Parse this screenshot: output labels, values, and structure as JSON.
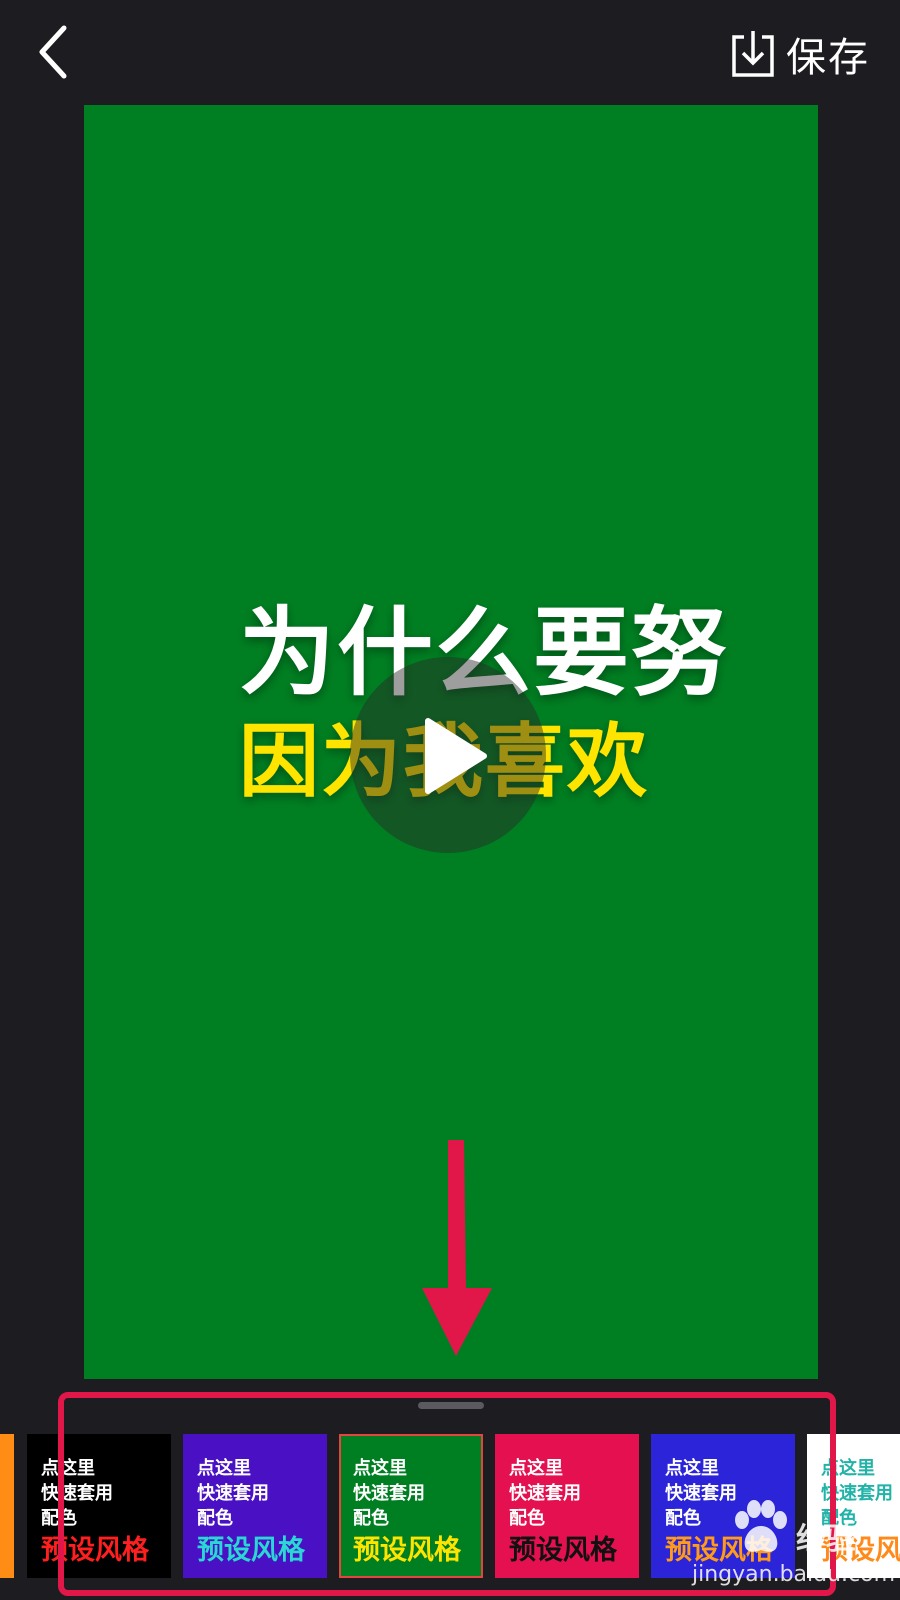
{
  "header": {
    "save_label": "保存"
  },
  "video": {
    "line1": "为什么要努",
    "line2": "因为我喜欢",
    "background": "#007f22",
    "line1_color": "#ffffff",
    "line2_color": "#ffe400"
  },
  "style_cards": [
    {
      "line1": "",
      "line2": "",
      "line3": "",
      "title": "",
      "bg": "#ff8c14",
      "title_color": "#ffffff",
      "selected": false
    },
    {
      "line1": "点这里",
      "line2": "快速套用",
      "line3": "配色",
      "title": "预设风格",
      "bg": "#000000",
      "title_color": "#ff1f1f",
      "selected": false
    },
    {
      "line1": "点这里",
      "line2": "快速套用",
      "line3": "配色",
      "title": "预设风格",
      "bg": "#4a10c4",
      "title_color": "#2ad7d4",
      "selected": false
    },
    {
      "line1": "点这里",
      "line2": "快速套用",
      "line3": "配色",
      "title": "预设风格",
      "bg": "#007f22",
      "title_color": "#ffe400",
      "selected": true
    },
    {
      "line1": "点这里",
      "line2": "快速套用",
      "line3": "配色",
      "title": "预设风格",
      "bg": "#e5104f",
      "title_color": "#111111",
      "selected": false
    },
    {
      "line1": "点这里",
      "line2": "快速套用",
      "line3": "配色",
      "title": "预设风格",
      "bg": "#2b24d8",
      "title_color": "#ff9a1a",
      "selected": false
    },
    {
      "line1": "点这里",
      "line2": "快速套用",
      "line3": "配色",
      "title": "预设风格",
      "bg": "#ffffff",
      "title_color": "#ff8a1a",
      "line_color": "#21b3a8",
      "selected": false
    }
  ],
  "annotation": {
    "color": "#e11649"
  },
  "watermark": {
    "text": "经验",
    "url": "jingyan.baidu.com"
  }
}
